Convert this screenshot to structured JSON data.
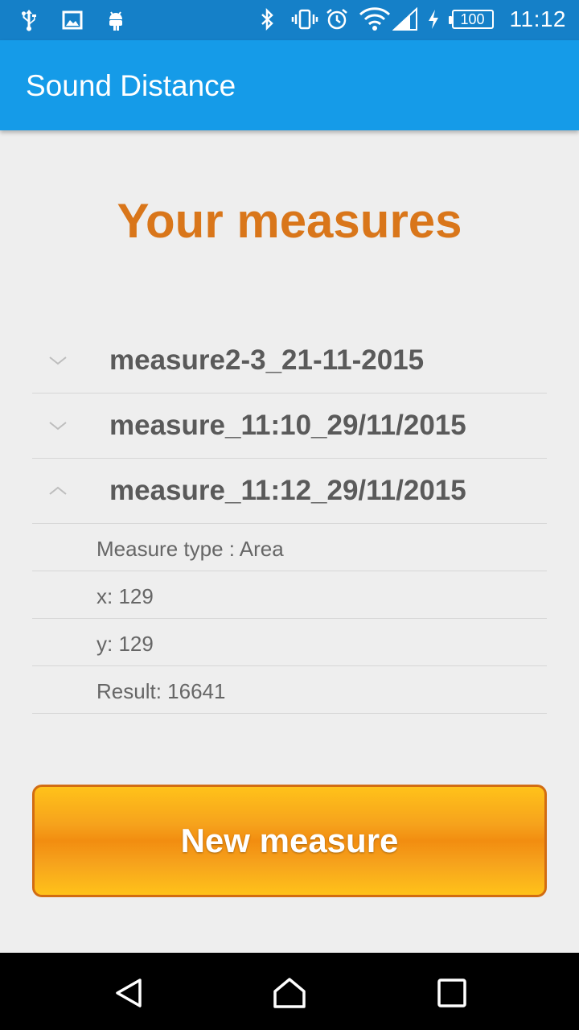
{
  "status_bar": {
    "time": "11:12",
    "battery": "100",
    "icons_left": [
      "usb-icon",
      "image-icon",
      "android-icon"
    ],
    "icons_right": [
      "bluetooth-icon",
      "vibrate-icon",
      "alarm-icon",
      "wifi-icon",
      "signal-icon",
      "charging-icon",
      "battery-icon"
    ]
  },
  "app_bar": {
    "title": "Sound Distance",
    "color": "#159be8"
  },
  "heading": "Your measures",
  "measures": [
    {
      "name": "measure2-3_21-11-2015",
      "expanded": false
    },
    {
      "name": "measure_11:10_29/11/2015",
      "expanded": false
    },
    {
      "name": "measure_11:12_29/11/2015",
      "expanded": true,
      "details": [
        "Measure type : Area",
        "x: 129",
        "y: 129",
        "Result: 16641"
      ]
    }
  ],
  "new_measure_button": "New measure",
  "nav_bar": [
    "back-icon",
    "home-icon",
    "recents-icon"
  ],
  "colors": {
    "accent_orange": "#d9761a",
    "button_orange": "#f6a21c"
  }
}
